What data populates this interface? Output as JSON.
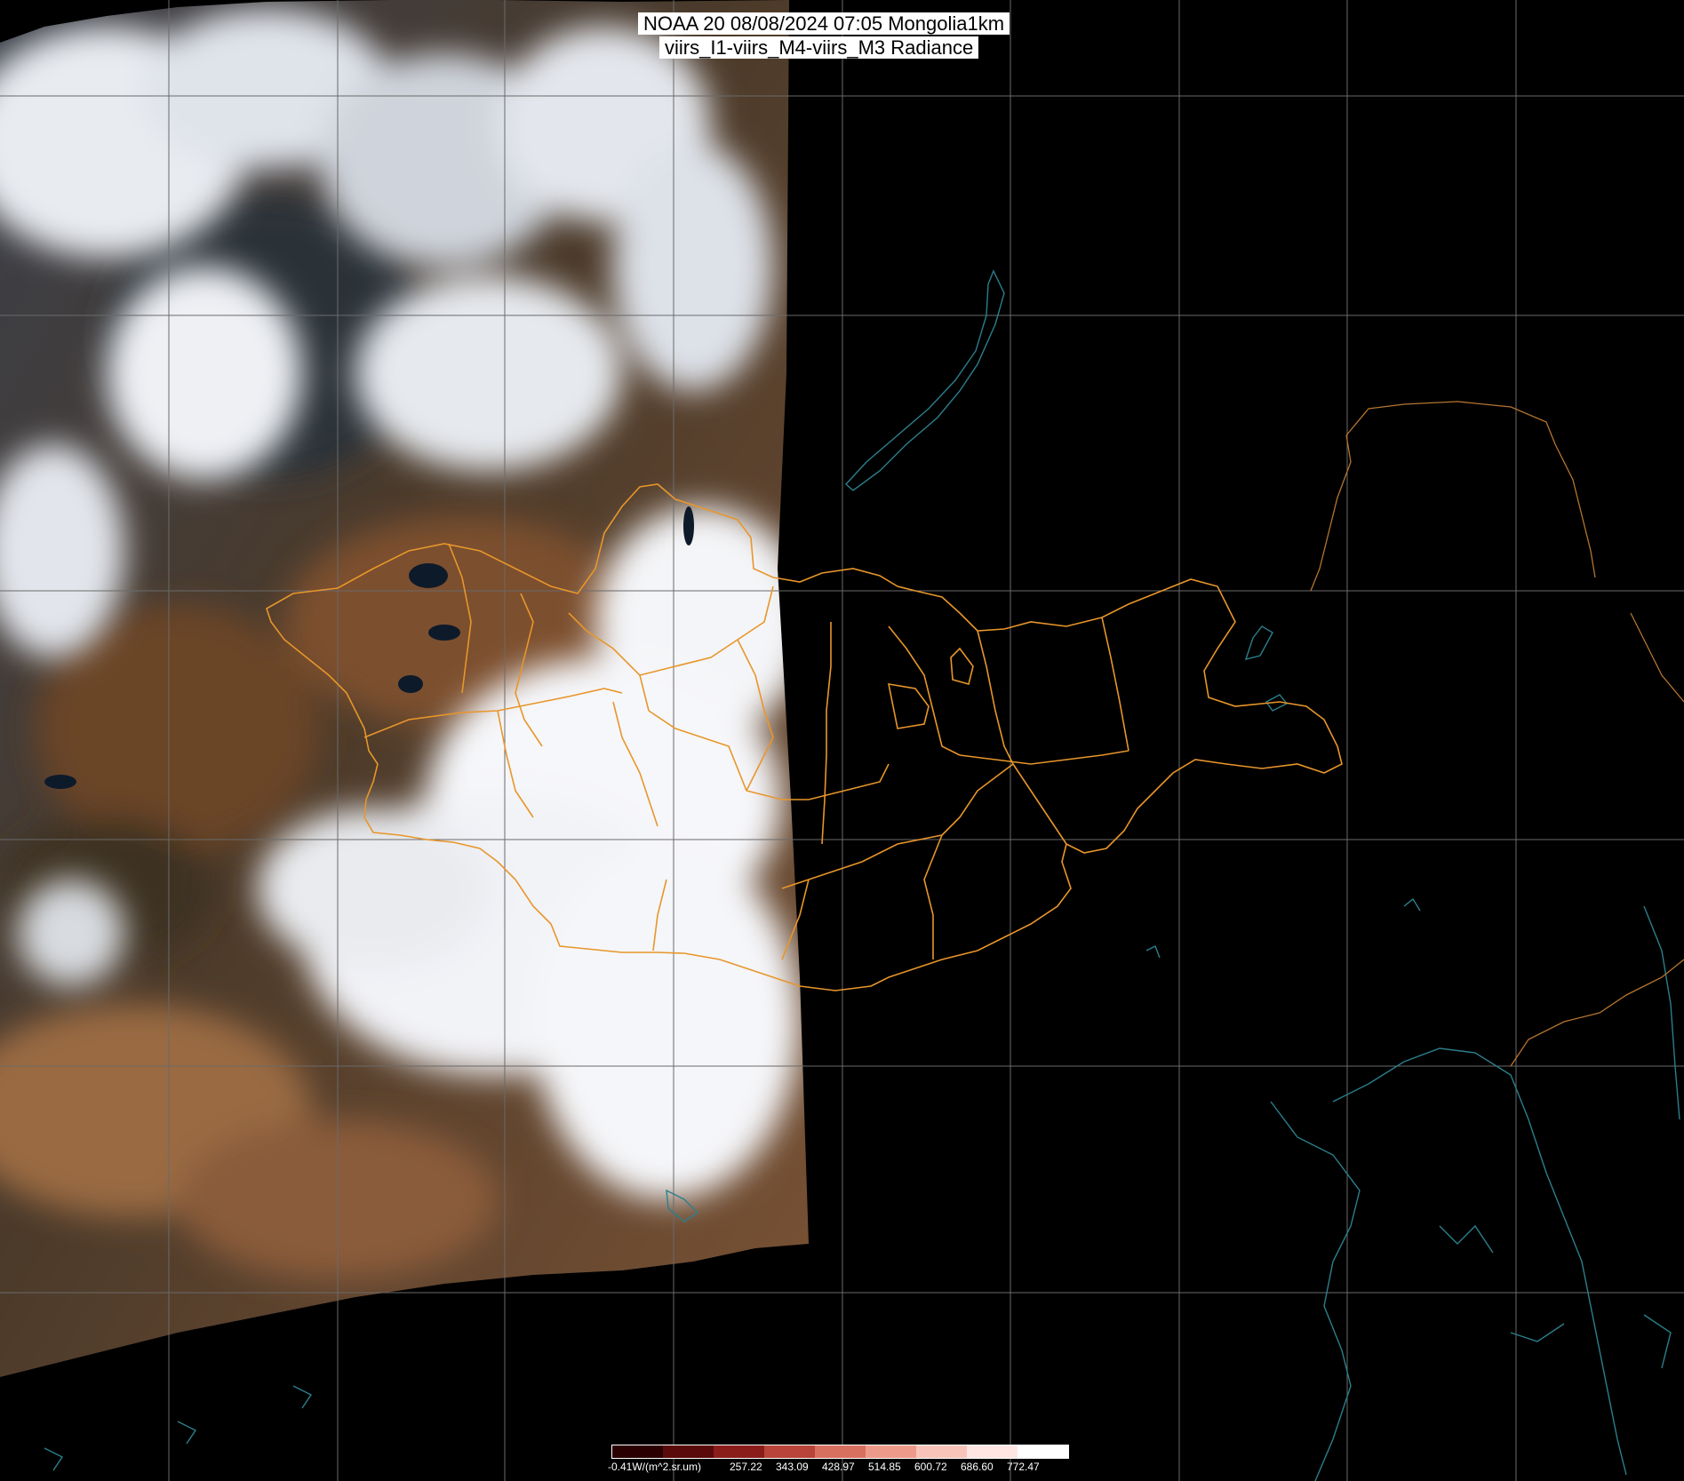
{
  "title": {
    "line1": "NOAA 20 08/08/2024 07:05 Mongolia1km",
    "line2": "viirs_I1-viirs_M4-viirs_M3 Radiance"
  },
  "colorbar": {
    "labels": [
      "-0.41W/(m^2.sr.um)",
      "257.22",
      "343.09",
      "428.97",
      "514.85",
      "600.72",
      "686.60",
      "772.47"
    ],
    "colors": [
      "#2a0000",
      "#5a0a0a",
      "#8a1d1a",
      "#b8443a",
      "#d8705f",
      "#ee9a8a",
      "#f8c4ba",
      "#ffe6e2",
      "#ffffff"
    ]
  },
  "map": {
    "imagery_type": "satellite true-color composite",
    "region": "Mongolia",
    "layers": [
      "satellite-swath",
      "lat-lon-grid",
      "mongolia-province-borders",
      "country-borders",
      "coastlines-lakes"
    ],
    "colors": {
      "grid": "#6a6a6a",
      "province_border": "#e8962a",
      "coastline": "#2b7f8c",
      "country_border": "#b57430",
      "cloud": "#f2f3f6",
      "desert": "#8a5a38",
      "steppe": "#4a3524"
    }
  }
}
